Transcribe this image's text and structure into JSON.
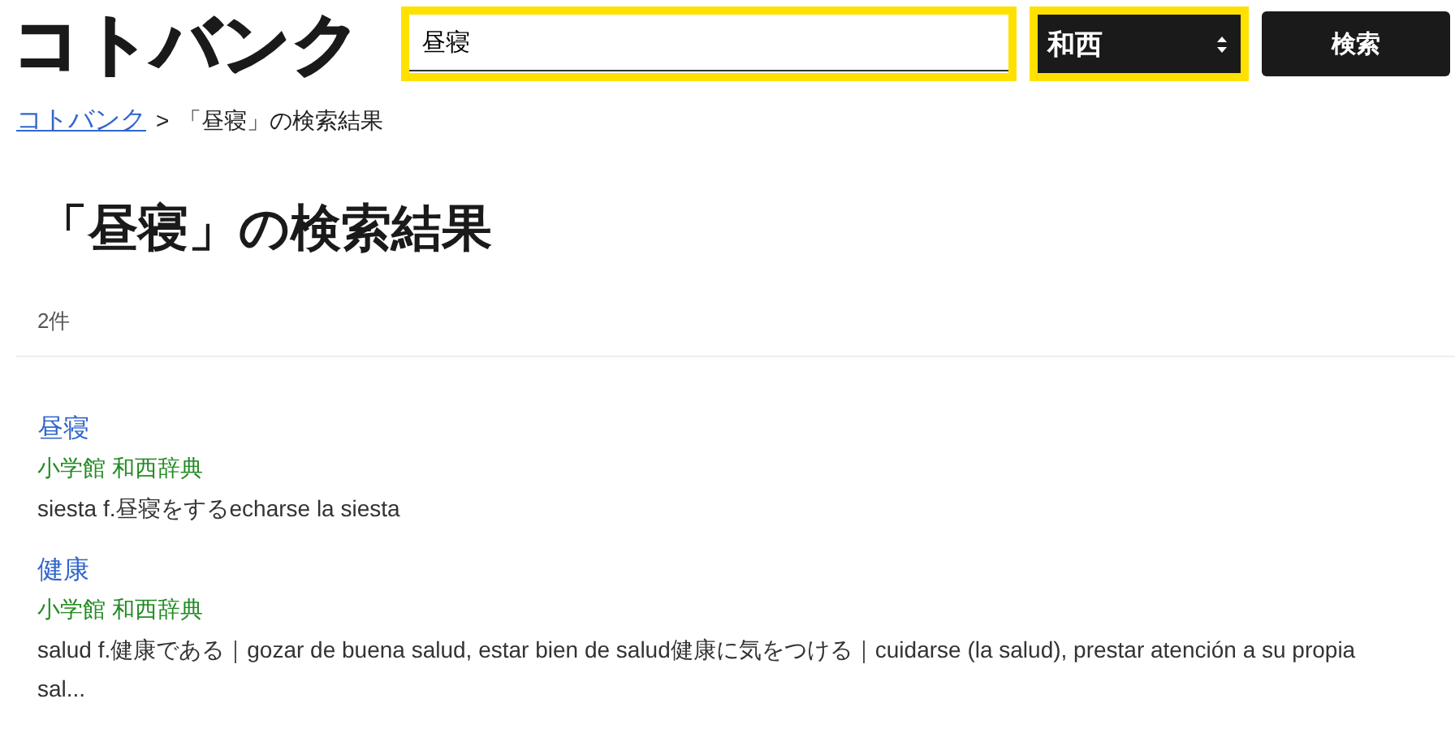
{
  "logo": "コトバンク",
  "search": {
    "value": "昼寝"
  },
  "dictionary_select": {
    "value": "和西"
  },
  "search_button": "検索",
  "breadcrumb": [
    {
      "label": "コトバンク",
      "link": true
    },
    {
      "label": "「昼寝」の検索結果",
      "link": false
    }
  ],
  "breadcrumb_separator": ">",
  "heading": "「昼寝」の検索結果",
  "count": "2件",
  "results": [
    {
      "title": "昼寝",
      "source": "小学館 和西辞典",
      "description": "siesta f.昼寝をするecharse la siesta"
    },
    {
      "title": "健康",
      "source": "小学館 和西辞典",
      "description": "salud f.健康である｜gozar de buena salud, estar bien de salud健康に気をつける｜cuidarse (la salud), prestar atención a su propia sal..."
    }
  ]
}
